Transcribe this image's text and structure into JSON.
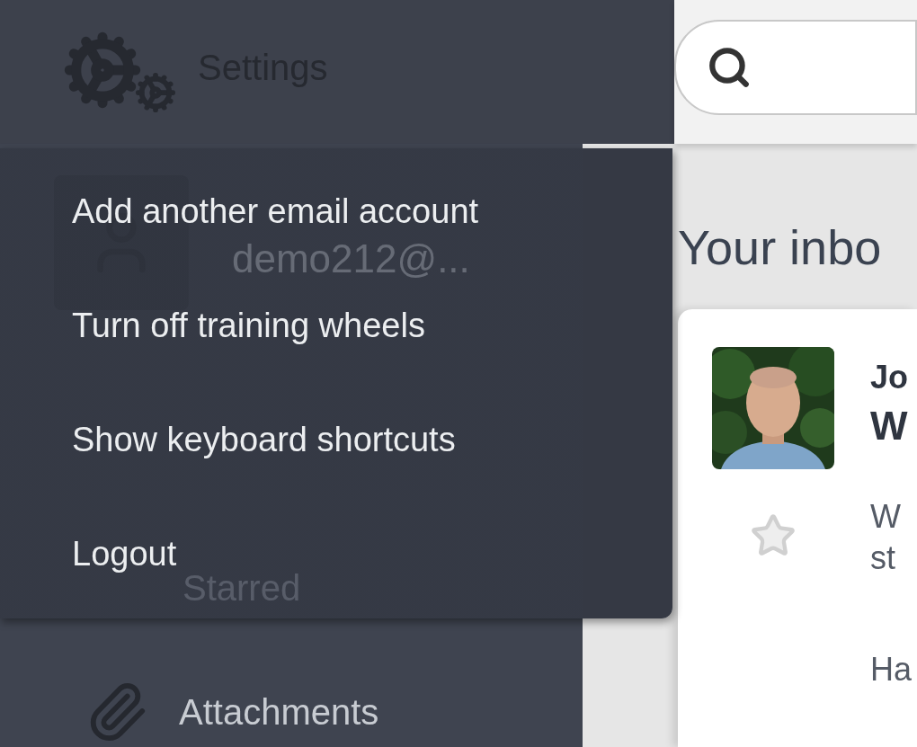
{
  "header": {
    "title": "Settings"
  },
  "settings_menu": {
    "items": [
      {
        "label": "Add another email account"
      },
      {
        "label": "Turn off training wheels"
      },
      {
        "label": "Show keyboard shortcuts"
      },
      {
        "label": "Logout"
      }
    ]
  },
  "sidebar": {
    "account": "demo212@...",
    "items": [
      {
        "label": "Starred"
      },
      {
        "label": "Attachments"
      }
    ]
  },
  "content": {
    "heading": "Your inbo",
    "message": {
      "sender": "Jo",
      "subject": "W",
      "starred": false,
      "preview_lines": [
        "W",
        "st"
      ],
      "body": "Ha"
    }
  }
}
